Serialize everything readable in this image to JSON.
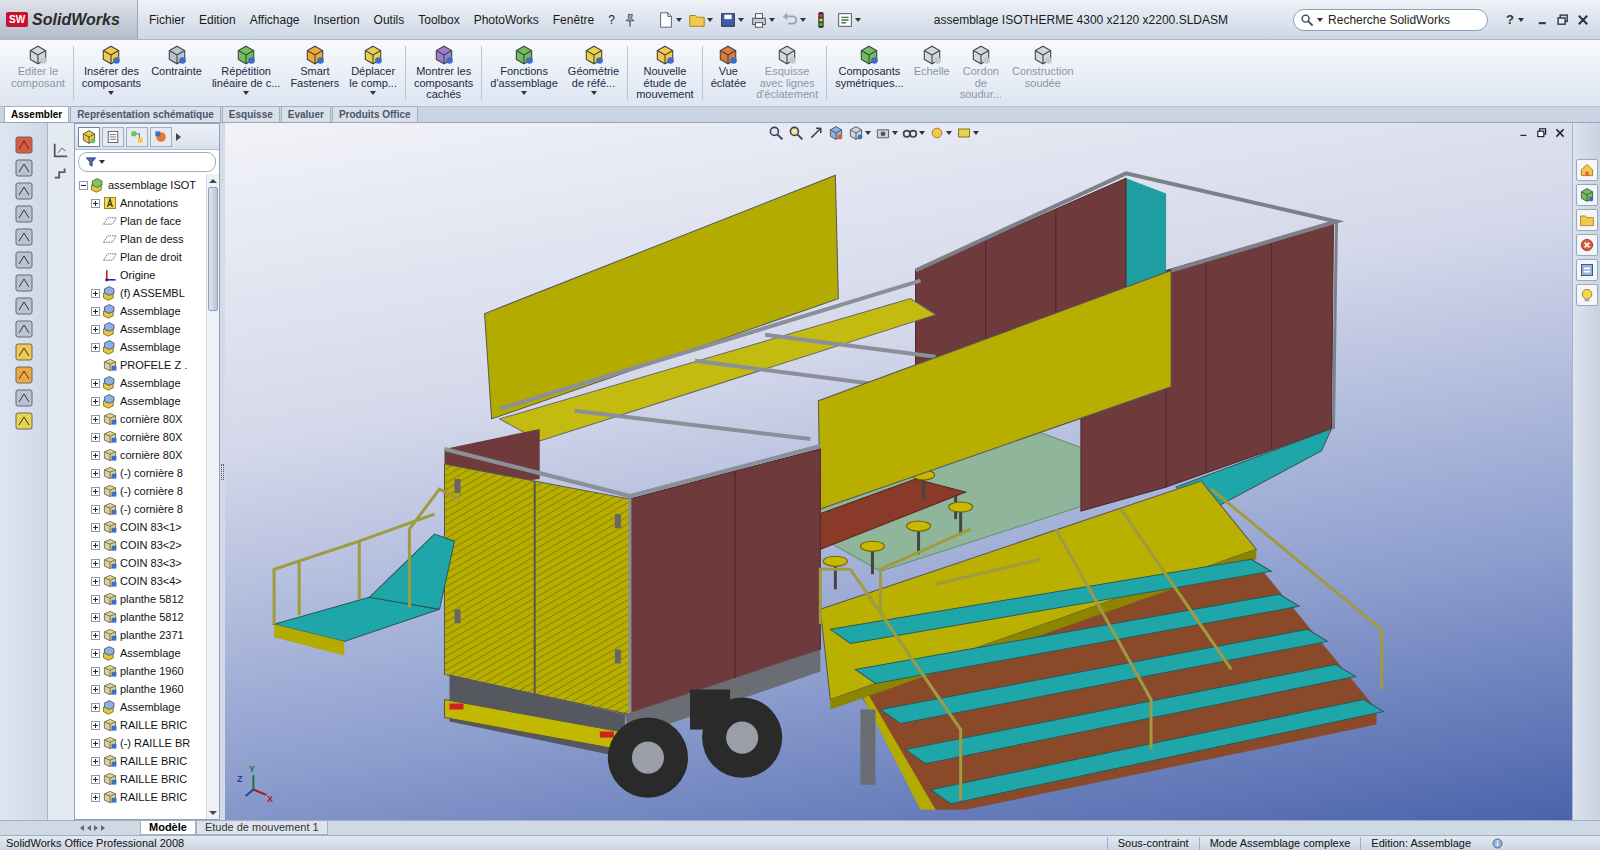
{
  "window": {
    "title": "assemblage ISOTHERME 4300 x2120 x2200.SLDASM"
  },
  "logo": {
    "mark": "SW",
    "text": "SolidWorks"
  },
  "menus": [
    "Fichier",
    "Edition",
    "Affichage",
    "Insertion",
    "Outils",
    "Toolbox",
    "PhotoWorks",
    "Fenêtre",
    "?"
  ],
  "standard_toolbar": [
    {
      "dropdown": true,
      "disabled": false
    },
    {
      "dropdown": true,
      "disabled": false
    },
    {
      "dropdown": true,
      "disabled": false
    },
    {
      "dropdown": true,
      "disabled": false
    },
    {
      "dropdown": true,
      "disabled": true
    },
    {
      "dropdown": false,
      "disabled": false
    },
    {
      "dropdown": true,
      "disabled": false
    }
  ],
  "search": {
    "placeholder": "Recherche SolidWorks",
    "dropdown": true
  },
  "help": {
    "label": "?",
    "dropdown": true
  },
  "ribbon": {
    "groups": [
      [
        {
          "lines": [
            "Editer le",
            "composant"
          ],
          "dropdown": false,
          "disabled": true
        }
      ],
      [
        {
          "lines": [
            "Insérer des",
            "composants"
          ],
          "dropdown": true,
          "disabled": false
        },
        {
          "lines": [
            "Contrainte"
          ],
          "dropdown": false,
          "disabled": false
        },
        {
          "lines": [
            "Répétition",
            "linéaire de c..."
          ],
          "dropdown": true,
          "disabled": false
        },
        {
          "lines": [
            "Smart",
            "Fasteners"
          ],
          "dropdown": false,
          "disabled": false
        },
        {
          "lines": [
            "Déplacer",
            "le comp..."
          ],
          "dropdown": true,
          "disabled": false
        }
      ],
      [
        {
          "lines": [
            "Montrer les",
            "composants",
            "cachés"
          ],
          "dropdown": false,
          "disabled": false
        }
      ],
      [
        {
          "lines": [
            "Fonctions",
            "d'assemblage"
          ],
          "dropdown": true,
          "disabled": false
        },
        {
          "lines": [
            "Géométrie",
            "de réfé..."
          ],
          "dropdown": true,
          "disabled": false
        }
      ],
      [
        {
          "lines": [
            "Nouvelle",
            "étude de",
            "mouvement"
          ],
          "dropdown": false,
          "disabled": false
        }
      ],
      [
        {
          "lines": [
            "Vue",
            "éclatée"
          ],
          "dropdown": false,
          "disabled": false
        },
        {
          "lines": [
            "Esquisse",
            "avec lignes",
            "d'éclatement"
          ],
          "dropdown": false,
          "disabled": true
        }
      ],
      [
        {
          "lines": [
            "Composants",
            "symétriques..."
          ],
          "dropdown": false,
          "disabled": false
        },
        {
          "lines": [
            "Echelle"
          ],
          "dropdown": false,
          "disabled": true
        },
        {
          "lines": [
            "Cordon",
            "de",
            "soudur..."
          ],
          "dropdown": false,
          "disabled": true
        },
        {
          "lines": [
            "Construction",
            "soudée"
          ],
          "dropdown": false,
          "disabled": true
        }
      ]
    ]
  },
  "tabs": [
    {
      "label": "Assembler",
      "selected": true
    },
    {
      "label": "Représentation schématique",
      "selected": false
    },
    {
      "label": "Esquisse",
      "selected": false
    },
    {
      "label": "Evaluer",
      "selected": false
    },
    {
      "label": "Produits Office",
      "selected": false
    }
  ],
  "panel_tabs": [
    {
      "selected": true
    },
    {
      "selected": false
    },
    {
      "selected": false
    },
    {
      "selected": false
    }
  ],
  "tree": {
    "scroll_level": 0.2,
    "items": [
      {
        "label": "assemblage ISOT",
        "kind": "root",
        "expandable": true,
        "expanded": true
      },
      {
        "label": "Annotations",
        "kind": "annotations",
        "expandable": true,
        "expanded": false
      },
      {
        "label": "Plan de face",
        "kind": "plane",
        "expandable": false,
        "expanded": false
      },
      {
        "label": "Plan de dess",
        "kind": "plane",
        "expandable": false,
        "expanded": false
      },
      {
        "label": "Plan de droit",
        "kind": "plane",
        "expandable": false,
        "expanded": false
      },
      {
        "label": "Origine",
        "kind": "origin",
        "expandable": false,
        "expanded": false
      },
      {
        "label": "(f) ASSEMBL",
        "kind": "assembly",
        "expandable": true,
        "expanded": false
      },
      {
        "label": "Assemblage",
        "kind": "assembly",
        "expandable": true,
        "expanded": false
      },
      {
        "label": "Assemblage",
        "kind": "assembly",
        "expandable": true,
        "expanded": false
      },
      {
        "label": "Assemblage",
        "kind": "assembly",
        "expandable": true,
        "expanded": false
      },
      {
        "label": "PROFELE Z .",
        "kind": "part",
        "expandable": false,
        "expanded": false
      },
      {
        "label": "Assemblage",
        "kind": "assembly",
        "expandable": true,
        "expanded": false
      },
      {
        "label": "Assemblage",
        "kind": "assembly",
        "expandable": true,
        "expanded": false
      },
      {
        "label": "cornière 80X",
        "kind": "part",
        "expandable": true,
        "expanded": false
      },
      {
        "label": "cornière 80X",
        "kind": "part",
        "expandable": true,
        "expanded": false
      },
      {
        "label": "cornière 80X",
        "kind": "part",
        "expandable": true,
        "expanded": false
      },
      {
        "label": "(-) cornière 8",
        "kind": "part",
        "expandable": true,
        "expanded": false
      },
      {
        "label": "(-) cornière 8",
        "kind": "part",
        "expandable": true,
        "expanded": false
      },
      {
        "label": "(-) cornière 8",
        "kind": "part",
        "expandable": true,
        "expanded": false
      },
      {
        "label": "COIN 83<1>",
        "kind": "part",
        "expandable": true,
        "expanded": false
      },
      {
        "label": "COIN 83<2>",
        "kind": "part",
        "expandable": true,
        "expanded": false
      },
      {
        "label": "COIN 83<3>",
        "kind": "part",
        "expandable": true,
        "expanded": false
      },
      {
        "label": "COIN 83<4>",
        "kind": "part",
        "expandable": true,
        "expanded": false
      },
      {
        "label": "planthe 5812",
        "kind": "part",
        "expandable": true,
        "expanded": false
      },
      {
        "label": "planthe 5812",
        "kind": "part",
        "expandable": true,
        "expanded": false
      },
      {
        "label": "planthe 2371",
        "kind": "part",
        "expandable": true,
        "expanded": false
      },
      {
        "label": "Assemblage",
        "kind": "assembly",
        "expandable": true,
        "expanded": false
      },
      {
        "label": "planthe 1960",
        "kind": "part",
        "expandable": true,
        "expanded": false
      },
      {
        "label": "planthe 1960",
        "kind": "part",
        "expandable": true,
        "expanded": false
      },
      {
        "label": "Assemblage",
        "kind": "assembly",
        "expandable": true,
        "expanded": false
      },
      {
        "label": "RAILLE BRIC",
        "kind": "part",
        "expandable": true,
        "expanded": false
      },
      {
        "label": "(-) RAILLE BR",
        "kind": "part",
        "expandable": true,
        "expanded": false
      },
      {
        "label": "RAILLE BRIC",
        "kind": "part",
        "expandable": true,
        "expanded": false
      },
      {
        "label": "RAILLE BRIC",
        "kind": "part",
        "expandable": true,
        "expanded": false
      },
      {
        "label": "RAILLE BRIC",
        "kind": "part",
        "expandable": true,
        "expanded": false
      }
    ]
  },
  "view_toolbar": [
    {
      "dropdown": false
    },
    {
      "dropdown": false
    },
    {
      "dropdown": false
    },
    {
      "dropdown": false
    },
    {
      "dropdown": true
    },
    {
      "dropdown": true
    },
    {
      "dropdown": true
    },
    {
      "dropdown": true
    },
    {
      "dropdown": true
    }
  ],
  "triad": {
    "z": "Z",
    "x": "X",
    "y": "Y"
  },
  "bottom_tabs": [
    {
      "label": "Modèle",
      "selected": true
    },
    {
      "label": "Etude de mouvement 1",
      "selected": false
    }
  ],
  "status_bar": {
    "product": "SolidWorks Office Professional 2008",
    "fields": [
      "Sous-contraint",
      "Mode Assemblage complexe",
      "Edition: Assemblage"
    ]
  }
}
